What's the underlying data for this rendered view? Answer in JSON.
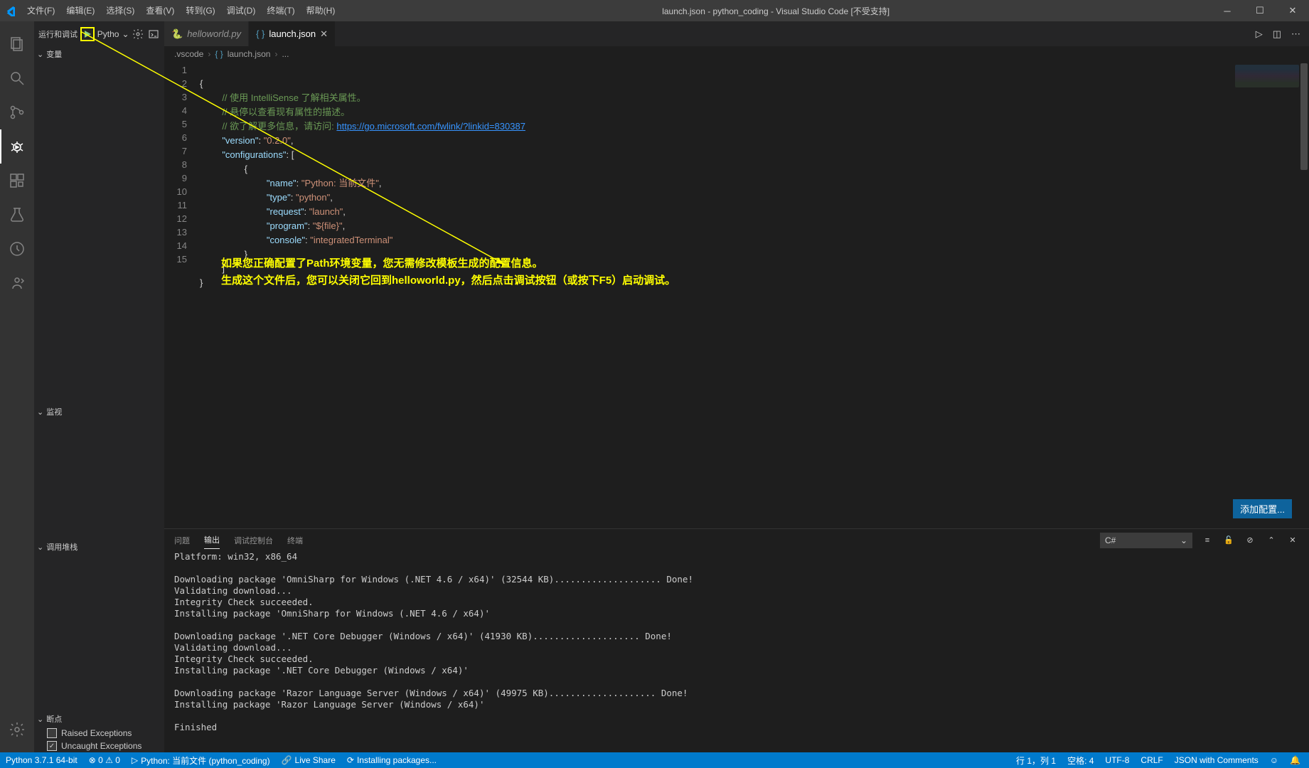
{
  "titlebar": {
    "menu": [
      "文件(F)",
      "编辑(E)",
      "选择(S)",
      "查看(V)",
      "转到(G)",
      "调试(D)",
      "终端(T)",
      "帮助(H)"
    ],
    "title": "launch.json - python_coding - Visual Studio Code [不受支持]"
  },
  "sidebar": {
    "run_and_debug": "运行和调试",
    "config_name": "Pytho",
    "sections": {
      "variables": "变量",
      "watch": "监视",
      "callstack": "调用堆栈",
      "breakpoints": "断点"
    },
    "breakpoints": {
      "raised": "Raised Exceptions",
      "uncaught": "Uncaught Exceptions"
    }
  },
  "tabs": {
    "helloworld": "helloworld.py",
    "launch": "launch.json"
  },
  "breadcrumbs": {
    "folder": ".vscode",
    "file": "launch.json",
    "tail": "..."
  },
  "code": {
    "comment1": "// 使用 IntelliSense 了解相关属性。",
    "comment2": "// 悬停以查看现有属性的描述。",
    "comment3_prefix": "// 欲了解更多信息，请访问: ",
    "comment3_link": "https://go.microsoft.com/fwlink/?linkid=830387",
    "version_key": "\"version\"",
    "version_val": "\"0.2.0\"",
    "configurations_key": "\"configurations\"",
    "name_key": "\"name\"",
    "name_val": "\"Python: 当前文件\"",
    "type_key": "\"type\"",
    "type_val": "\"python\"",
    "request_key": "\"request\"",
    "request_val": "\"launch\"",
    "program_key": "\"program\"",
    "program_val": "\"${file}\"",
    "console_key": "\"console\"",
    "console_val": "\"integratedTerminal\""
  },
  "annotation": {
    "line1": "如果您正确配置了Path环境变量，您无需修改模板生成的配置信息。",
    "line2": "生成这个文件后，您可以关闭它回到helloworld.py，然后点击调试按钮（或按下F5）启动调试。"
  },
  "add_config_btn": "添加配置...",
  "panel": {
    "tabs": {
      "problems": "问题",
      "output": "输出",
      "debug_console": "调试控制台",
      "terminal": "终端"
    },
    "filter": "C#",
    "output_text": "Platform: win32, x86_64\n\nDownloading package 'OmniSharp for Windows (.NET 4.6 / x64)' (32544 KB).................... Done!\nValidating download...\nIntegrity Check succeeded.\nInstalling package 'OmniSharp for Windows (.NET 4.6 / x64)'\n\nDownloading package '.NET Core Debugger (Windows / x64)' (41930 KB).................... Done!\nValidating download...\nIntegrity Check succeeded.\nInstalling package '.NET Core Debugger (Windows / x64)'\n\nDownloading package 'Razor Language Server (Windows / x64)' (49975 KB).................... Done!\nInstalling package 'Razor Language Server (Windows / x64)'\n\nFinished"
  },
  "statusbar": {
    "python": "Python 3.7.1 64-bit",
    "problems": "⊗ 0 ⚠ 0",
    "config": "Python: 当前文件 (python_coding)",
    "liveshare": "Live Share",
    "installing": "Installing packages...",
    "line_col": "行 1，列 1",
    "spaces": "空格: 4",
    "encoding": "UTF-8",
    "eol": "CRLF",
    "language": "JSON with Comments",
    "feedback": "☺"
  }
}
